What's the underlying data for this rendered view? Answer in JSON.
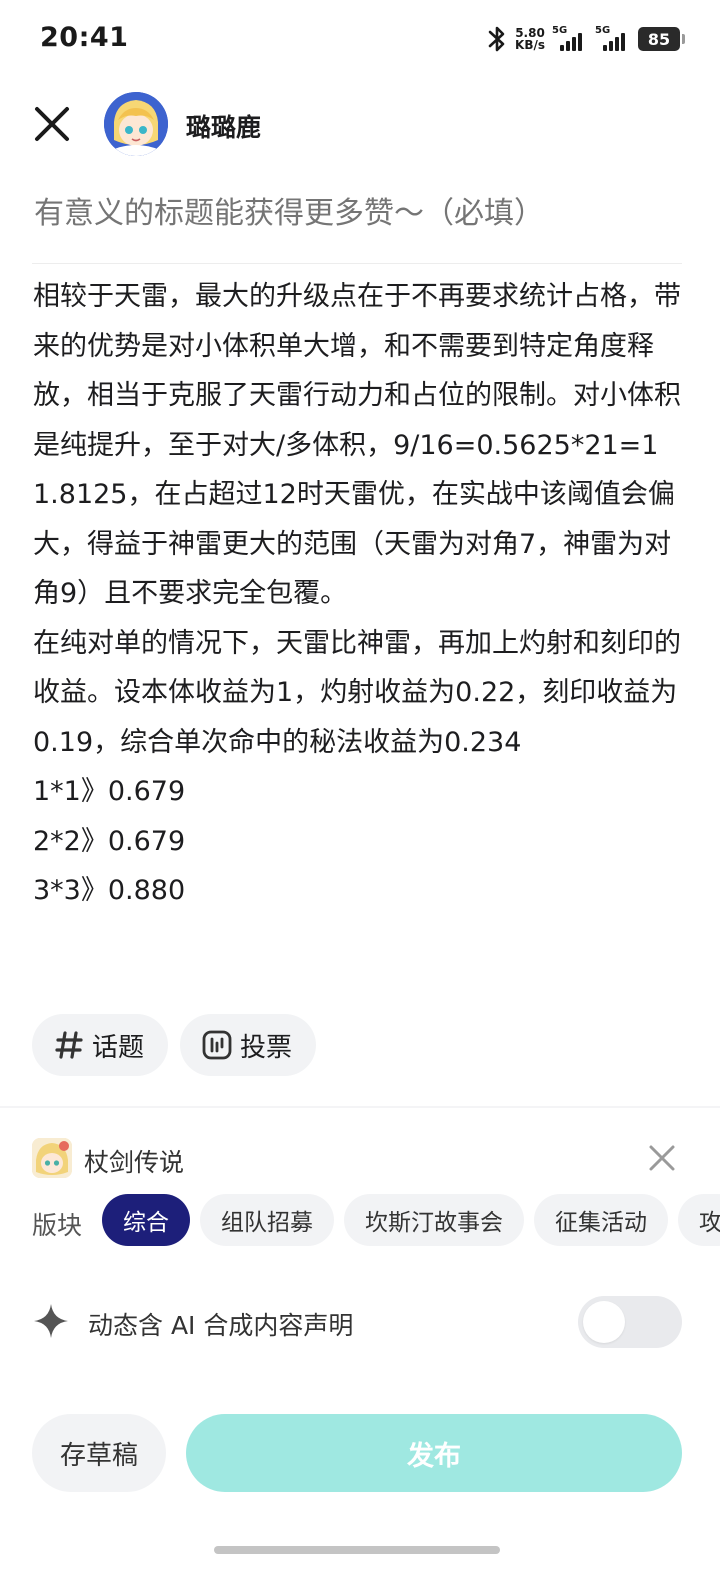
{
  "status_bar": {
    "time": "20:41",
    "net_speed_value": "5.80",
    "net_speed_unit": "KB/s",
    "sim1_label": "5G",
    "sim2_label": "5G",
    "battery": "85"
  },
  "header": {
    "user_name": "璐璐鹿"
  },
  "editor": {
    "title_placeholder": "有意义的标题能获得更多赞～（必填）",
    "title_value": "",
    "body": "相较于天雷，最大的升级点在于不再要求统计占格，带来的优势是对小体积单大增，和不需要到特定角度释放，相当于克服了天雷行动力和占位的限制。对小体积是纯提升，至于对大/多体积，9/16=0.5625*21=11.8125，在占超过12时天雷优，在实战中该阈值会偏大，得益于神雷更大的范围（天雷为对角7，神雷为对角9）且不要求完全包覆。\n在纯对单的情况下，天雷比神雷，再加上灼射和刻印的收益。设本体收益为1，灼射收益为0.22，刻印收益为0.19，综合单次命中的秘法收益为0.234\n1*1》0.679\n2*2》0.679\n3*3》0.880"
  },
  "chips": {
    "topic_label": "话题",
    "vote_label": "投票"
  },
  "game": {
    "name": "杖剑传说"
  },
  "board": {
    "label": "版块",
    "tags": [
      "综合",
      "组队招募",
      "坎斯汀故事会",
      "征集活动",
      "攻"
    ],
    "active_index": 0
  },
  "ai_declaration": {
    "label": "动态含 AI 合成内容声明",
    "enabled": false
  },
  "actions": {
    "draft_label": "存草稿",
    "publish_label": "发布"
  },
  "colors": {
    "accent_active_tag": "#1d1f7a",
    "publish_disabled": "#9fe8e1",
    "placeholder": "#c3c5ca"
  }
}
